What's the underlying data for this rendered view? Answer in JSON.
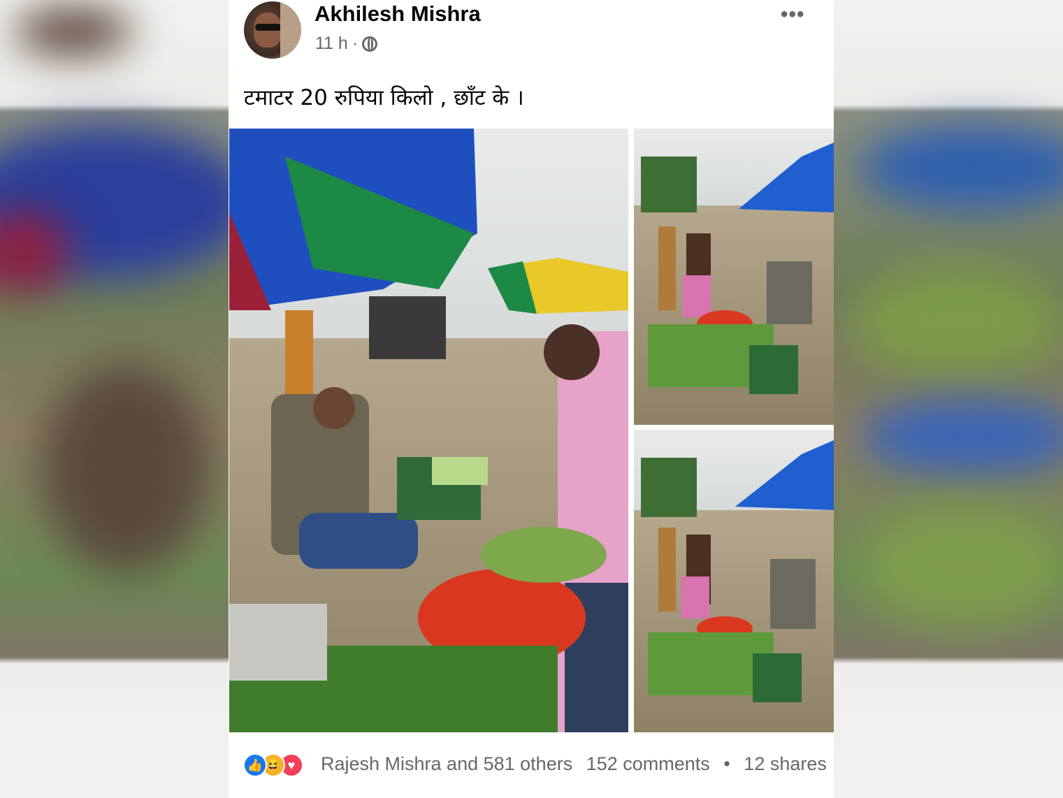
{
  "post": {
    "author": "Akhilesh Mishra",
    "time": "11 h",
    "separator": "·",
    "text": "टमाटर 20 रुपिया किलो , छाँट के ।",
    "more_label": "•••"
  },
  "icons": {
    "audience": "globe-icon",
    "more": "more-icon",
    "reactions": [
      "like-icon",
      "haha-icon",
      "love-icon"
    ]
  },
  "reactions": {
    "like_glyph": "👍",
    "haha_glyph": "😆",
    "love_glyph": "♥",
    "summary": "Rajesh Mishra and 581 others",
    "comments": "152 comments",
    "dot": "•",
    "shares": "12 shares"
  },
  "colors": {
    "like": "#1877f2",
    "haha": "#f7b125",
    "love": "#f33e58",
    "secondary_text": "#65676b"
  }
}
